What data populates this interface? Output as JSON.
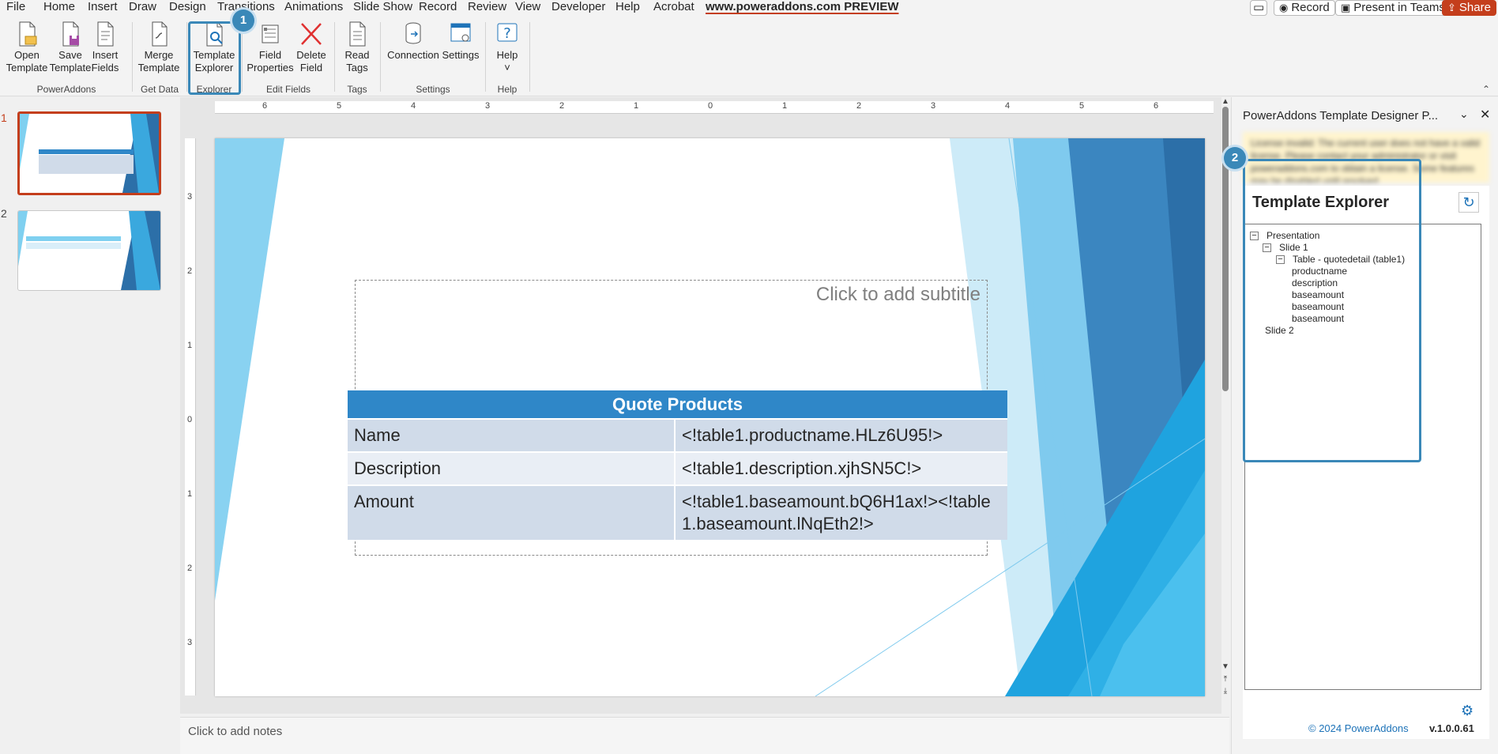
{
  "menu": {
    "tabs": [
      "File",
      "Home",
      "Insert",
      "Draw",
      "Design",
      "Transitions",
      "Animations",
      "Slide Show",
      "Record",
      "Review",
      "View",
      "Developer",
      "Help",
      "Acrobat",
      "www.poweraddons.com PREVIEW"
    ],
    "active_tab": "www.poweraddons.com PREVIEW",
    "record_label": "Record",
    "present_label": "Present in Teams",
    "share_label": "Share"
  },
  "ribbon": {
    "groups": [
      {
        "label": "PowerAddons",
        "buttons": [
          {
            "label": "Open\nTemplate"
          },
          {
            "label": "Save\nTemplate"
          },
          {
            "label": "Insert\nFields"
          }
        ]
      },
      {
        "label": "Get Data",
        "buttons": [
          {
            "label": "Merge\nTemplate"
          }
        ]
      },
      {
        "label": "Explorer",
        "buttons": [
          {
            "label": "Template\nExplorer"
          }
        ]
      },
      {
        "label": "Edit Fields",
        "buttons": [
          {
            "label": "Field\nProperties"
          },
          {
            "label": "Delete\nField"
          }
        ]
      },
      {
        "label": "Tags",
        "buttons": [
          {
            "label": "Read\nTags"
          }
        ]
      },
      {
        "label": "Settings",
        "buttons": [
          {
            "label": "Connection"
          },
          {
            "label": "Settings"
          }
        ]
      },
      {
        "label": "Help",
        "buttons": [
          {
            "label": "Help\n˅"
          }
        ]
      }
    ]
  },
  "callouts": [
    "1",
    "2"
  ],
  "thumbnails": [
    "1",
    "2"
  ],
  "ruler": {
    "h": [
      "6",
      "5",
      "4",
      "3",
      "2",
      "1",
      "0",
      "1",
      "2",
      "3",
      "4",
      "5",
      "6"
    ],
    "v": [
      "3",
      "2",
      "1",
      "0",
      "1",
      "2",
      "3"
    ]
  },
  "slide": {
    "subtitle_placeholder": "Click to add subtitle",
    "table": {
      "title": "Quote Products",
      "rows": [
        {
          "label": "Name",
          "value": "<!table1.productname.HLz6U95!>"
        },
        {
          "label": "Description",
          "value": "<!table1.description.xjhSN5C!>"
        },
        {
          "label": "Amount",
          "value": "<!table1.baseamount.bQ6H1ax!><!table1.baseamount.lNqEth2!>"
        }
      ]
    }
  },
  "notes_placeholder": "Click to add notes",
  "pane": {
    "title": "PowerAddons Template Designer P...",
    "license_message": "License invalid: The current user does not have a valid license. Please contact your administrator or visit poweraddons.com to obtain a license. Some features may be disabled until resolved.",
    "explorer_title": "Template Explorer",
    "tree": [
      {
        "label": "Presentation",
        "level": 0,
        "expander": "−"
      },
      {
        "label": "Slide 1",
        "level": 1,
        "expander": "−"
      },
      {
        "label": "Table - quotedetail (table1)",
        "level": 2,
        "expander": "−"
      },
      {
        "label": "productname",
        "level": 3,
        "expander": ""
      },
      {
        "label": "description",
        "level": 3,
        "expander": ""
      },
      {
        "label": "baseamount",
        "level": 3,
        "expander": ""
      },
      {
        "label": "baseamount",
        "level": 3,
        "expander": ""
      },
      {
        "label": "baseamount",
        "level": 3,
        "expander": ""
      },
      {
        "label": "Slide 2",
        "level": 0,
        "expander": ""
      }
    ],
    "copyright": "© 2024 PowerAddons",
    "version": "v.1.0.0.61"
  },
  "colors": {
    "accent": "#c43e1c",
    "callout": "#3a88b8",
    "table_header": "#2f87c8",
    "link": "#1e73b8"
  }
}
